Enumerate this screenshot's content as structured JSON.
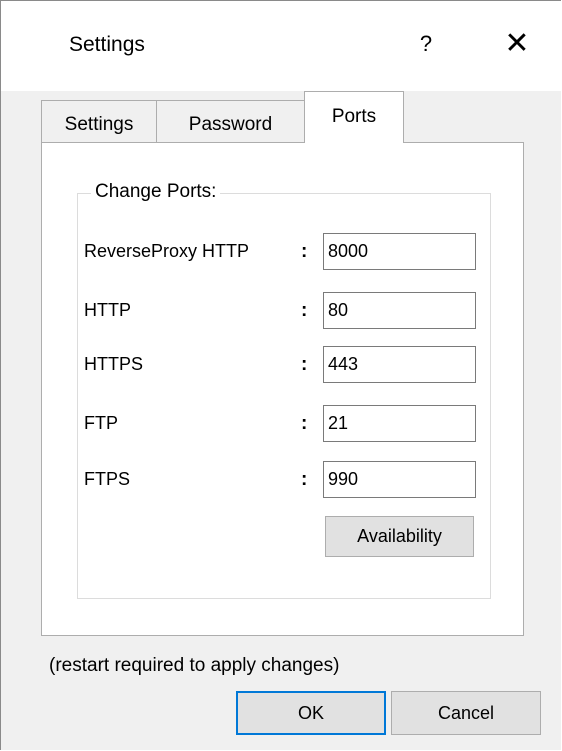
{
  "window": {
    "title": "Settings",
    "help_label": "?",
    "close_label": "✕"
  },
  "tabs": [
    {
      "label": "Settings",
      "active": false
    },
    {
      "label": "Password",
      "active": false
    },
    {
      "label": "Ports",
      "active": true
    }
  ],
  "group": {
    "legend": "Change Ports:"
  },
  "ports": [
    {
      "label": "ReverseProxy HTTP",
      "colon": ":",
      "value": "8000"
    },
    {
      "label": "HTTP",
      "colon": ":",
      "value": "80"
    },
    {
      "label": "HTTPS",
      "colon": ":",
      "value": "443"
    },
    {
      "label": "FTP",
      "colon": ":",
      "value": "21"
    },
    {
      "label": "FTPS",
      "colon": ":",
      "value": "990"
    }
  ],
  "buttons": {
    "availability": "Availability",
    "ok": "OK",
    "cancel": "Cancel"
  },
  "note": "(restart required to apply changes)"
}
